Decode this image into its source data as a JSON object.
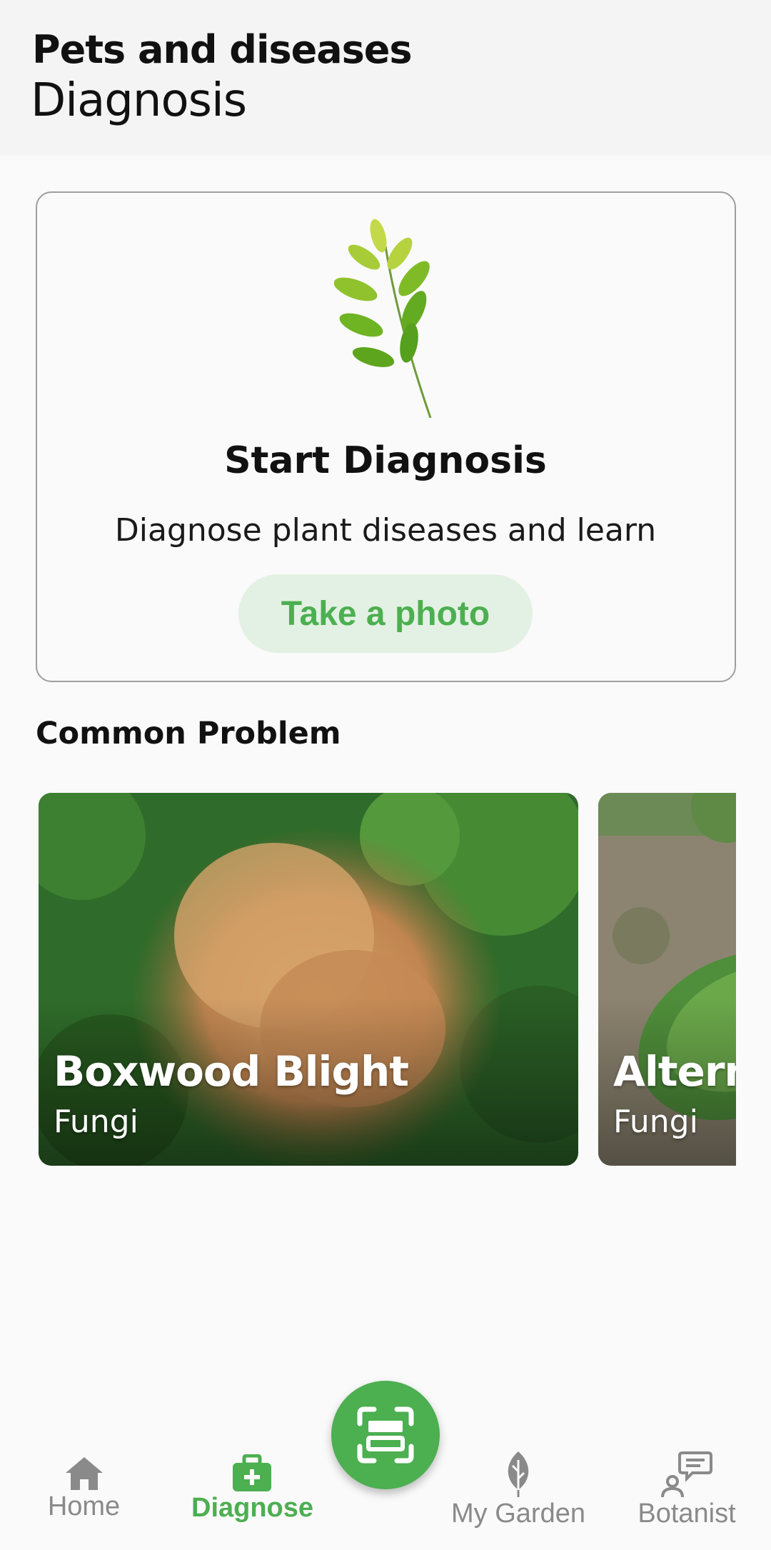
{
  "header": {
    "subtitle": "Pets and diseases",
    "title": "Diagnosis"
  },
  "diagnosis_card": {
    "title": "Start Diagnosis",
    "description": "Diagnose plant diseases and learn",
    "button_label": "Take a photo",
    "illustration": "leaf-branch-image"
  },
  "common_problem": {
    "section_title": "Common Problem",
    "cards": [
      {
        "name": "Boxwood Blight",
        "category": "Fungi"
      },
      {
        "name": "Alterna",
        "category": "Fungi"
      }
    ]
  },
  "bottom_nav": {
    "items": [
      {
        "label": "Home",
        "icon": "home-icon",
        "active": false
      },
      {
        "label": "Diagnose",
        "icon": "medical-kit-icon",
        "active": true
      },
      {
        "label": "My Garden",
        "icon": "leaf-icon",
        "active": false
      },
      {
        "label": "Botanist",
        "icon": "chat-person-icon",
        "active": false
      }
    ],
    "fab_icon": "scan-icon"
  },
  "colors": {
    "accent": "#4caf50",
    "button_bg": "#e3f1e4",
    "inactive": "#8a8a8a"
  }
}
